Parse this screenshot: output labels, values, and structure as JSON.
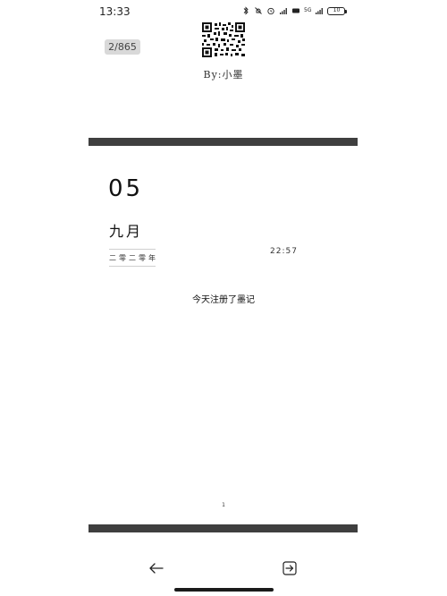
{
  "status_bar": {
    "time": "13:33",
    "signal_label": "5G",
    "battery_level": "10"
  },
  "header": {
    "page_indicator": "2/865",
    "author": "By:小墨"
  },
  "entry": {
    "day": "05",
    "month": "九月",
    "year": "二零二零年",
    "time": "22:57",
    "text": "今天注册了墨记"
  },
  "footer": {
    "page_number": "1"
  },
  "colors": {
    "divider": "#3f3f3f",
    "badge_bg": "#d9d9d9",
    "text": "#111111"
  },
  "icons": {
    "back": "arrow-left-icon",
    "share": "share-export-icon"
  }
}
